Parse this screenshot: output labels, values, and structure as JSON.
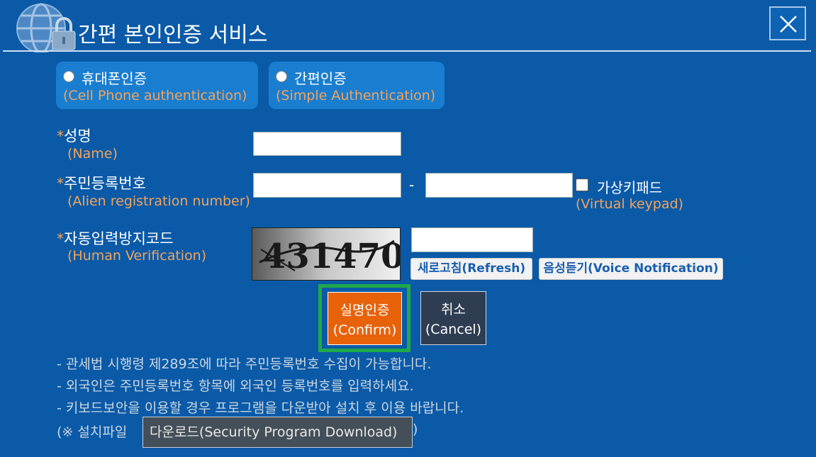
{
  "header": {
    "title": "간편 본인인증 서비스",
    "logo_icon": "globe-lock-icon",
    "close_icon": "close-icon"
  },
  "auth_options": [
    {
      "label": "휴대폰인증",
      "sub": "(Cell Phone authentication)",
      "selected": false
    },
    {
      "label": "간편인증",
      "sub": "(Simple Authentication)",
      "selected": false
    }
  ],
  "form": {
    "required_mark": "*",
    "name": {
      "label": "성명",
      "sub": "(Name)",
      "value": ""
    },
    "rrn": {
      "label": "주민등록번호",
      "sub": "(Alien registration number)",
      "value_front": "",
      "value_back": "",
      "separator": "-"
    },
    "virtual_keypad": {
      "label": "가상키패드",
      "sub": "(Virtual keypad)",
      "checked": false
    },
    "captcha": {
      "label": "자동입력방지코드",
      "sub": "(Human Verification)",
      "image_text": "431470",
      "value": "",
      "refresh_label": "새로고침(Refresh)",
      "voice_label": "음성듣기(Voice Notification)"
    }
  },
  "actions": {
    "confirm_line1": "실명인증",
    "confirm_line2": "(Confirm)",
    "cancel_line1": "취소",
    "cancel_line2": "(Cancel)"
  },
  "notes": [
    "- 관세법 시행령 제289조에 따라 주민등록번호 수집이 가능합니다.",
    "- 외국인은 주민등록번호 항목에 외국인 등록번호를 입력하세요.",
    "- 키보드보안을 이용할 경우 프로그램을 다운받아 설치 후 이용 바랍니다."
  ],
  "install": {
    "prefix": "(※ 설치파일",
    "download_label": "다운로드(Security Program Download)",
    "suffix": ")"
  },
  "colors": {
    "background": "#0a5aa8",
    "option_bg": "#1a7ed0",
    "accent_orange": "#f5a35a",
    "confirm": "#e8620a",
    "confirm_highlight": "#20a84a",
    "cancel": "#2e3d52"
  }
}
